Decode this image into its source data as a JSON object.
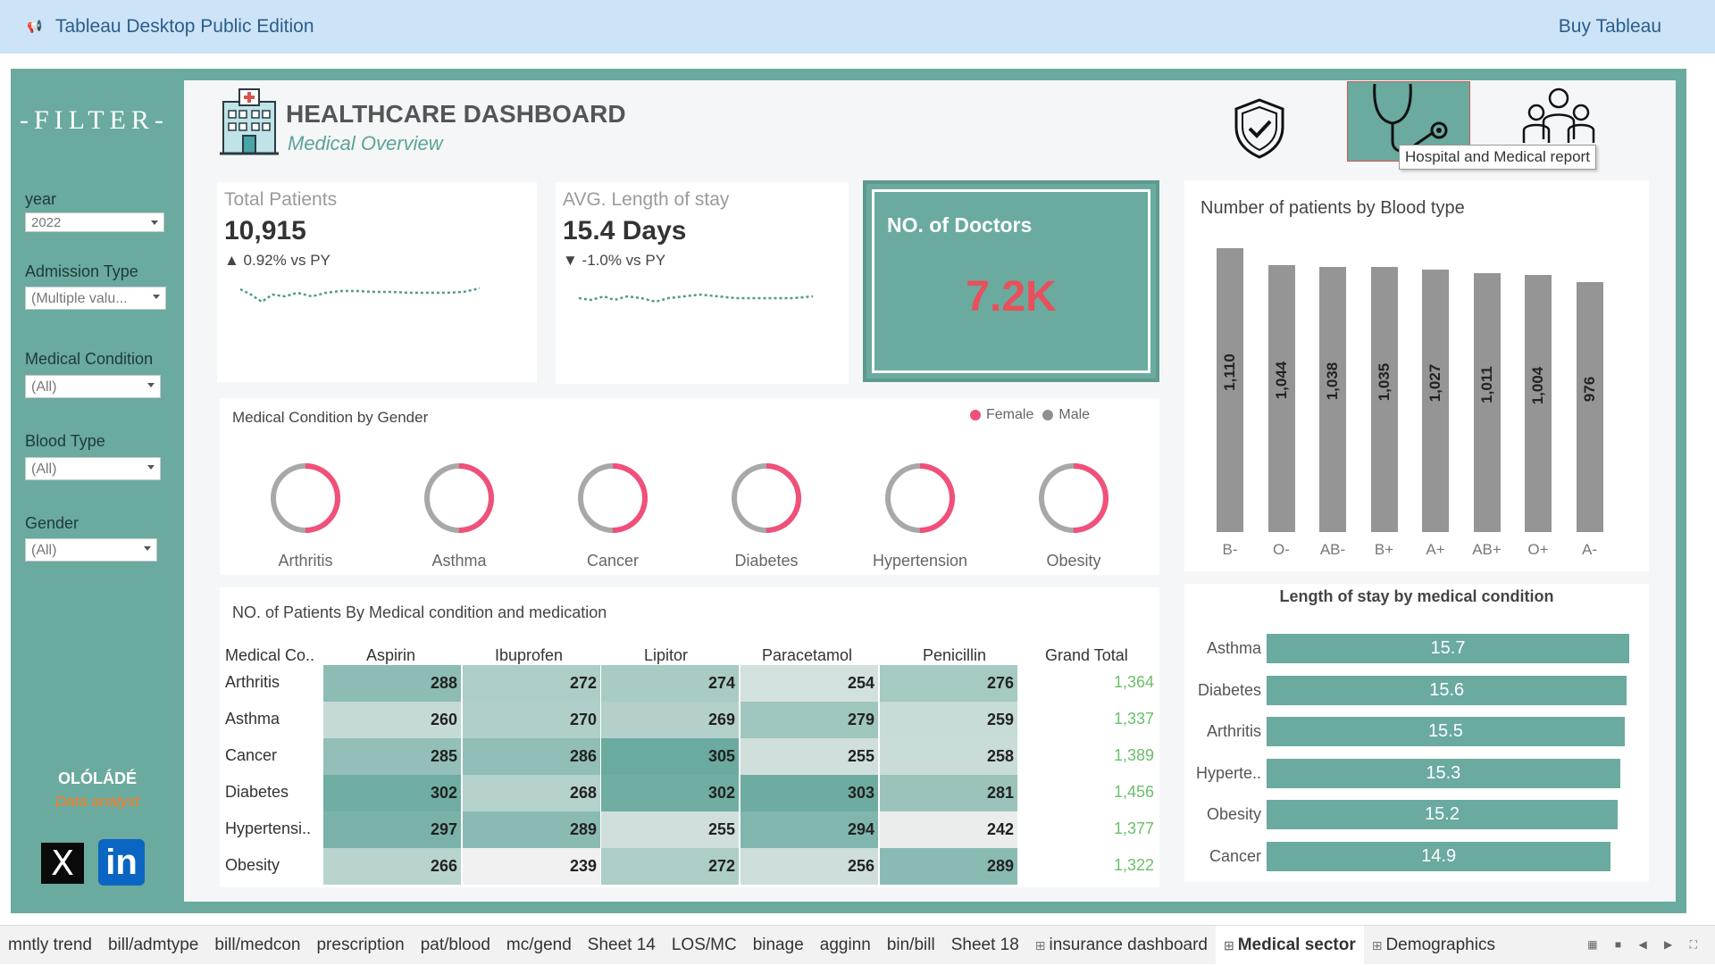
{
  "topbar": {
    "title": "Tableau Desktop Public Edition",
    "buy": "Buy Tableau",
    "icon": "tableau-icon"
  },
  "sidebar": {
    "title": "-FILTER-",
    "filters": [
      {
        "label": "year",
        "value": "2022"
      },
      {
        "label": "Admission Type",
        "value": "(Multiple valu..."
      },
      {
        "label": "Medical Condition",
        "value": "(All)"
      },
      {
        "label": "Blood Type",
        "value": "(All)"
      },
      {
        "label": "Gender",
        "value": "(All)"
      }
    ],
    "author": {
      "name": "OLÓLÁDÉ",
      "role": "Data analyst"
    },
    "social": {
      "x": "X",
      "linkedin": "in"
    }
  },
  "header": {
    "title": "HEALTHCARE DASHBOARD",
    "subtitle": "Medical Overview",
    "tooltip": "Hospital and Medical report"
  },
  "kpis": {
    "patients": {
      "label": "Total Patients",
      "value": "10,915",
      "delta": "▲ 0.92% vs PY"
    },
    "stay": {
      "label": "AVG. Length of stay",
      "value": "15.4 Days",
      "delta": "▼ -1.0% vs PY"
    },
    "doctors": {
      "label": "NO. of Doctors",
      "value": "7.2K"
    }
  },
  "gender_chart": {
    "title": "Medical Condition by Gender",
    "legend": [
      "Female",
      "Male"
    ],
    "colors": {
      "female": "#f0507a",
      "male": "#a8a8a8"
    },
    "conditions": [
      {
        "name": "Arthritis",
        "female": 0.5
      },
      {
        "name": "Asthma",
        "female": 0.5
      },
      {
        "name": "Cancer",
        "female": 0.5
      },
      {
        "name": "Diabetes",
        "female": 0.5
      },
      {
        "name": "Hypertension",
        "female": 0.5
      },
      {
        "name": "Obesity",
        "female": 0.5
      }
    ]
  },
  "table": {
    "title": "NO. of Patients By Medical condition and medication",
    "corner": "Medical Co..",
    "columns": [
      "Aspirin",
      "Ibuprofen",
      "Lipitor",
      "Paracetamol",
      "Penicillin"
    ],
    "grand_total_label": "Grand Total",
    "rows": [
      {
        "label": "Arthritis",
        "values": [
          288,
          272,
          274,
          254,
          276
        ],
        "total": "1,364"
      },
      {
        "label": "Asthma",
        "values": [
          260,
          270,
          269,
          279,
          259
        ],
        "total": "1,337"
      },
      {
        "label": "Cancer",
        "values": [
          285,
          286,
          305,
          255,
          258
        ],
        "total": "1,389"
      },
      {
        "label": "Diabetes",
        "values": [
          302,
          268,
          302,
          303,
          281
        ],
        "total": "1,456"
      },
      {
        "label": "Hypertensi..",
        "values": [
          297,
          289,
          255,
          294,
          242
        ],
        "total": "1,377"
      },
      {
        "label": "Obesity",
        "values": [
          266,
          239,
          272,
          256,
          289
        ],
        "total": "1,322"
      }
    ]
  },
  "chart_data": [
    {
      "type": "bar",
      "title": "Number of patients by Blood type",
      "categories": [
        "B-",
        "O-",
        "AB-",
        "B+",
        "A+",
        "AB+",
        "O+",
        "A-"
      ],
      "values": [
        1110,
        1044,
        1038,
        1035,
        1027,
        1011,
        1004,
        976
      ],
      "value_labels": [
        "1,110",
        "1,044",
        "1,038",
        "1,035",
        "1,027",
        "1,011",
        "1,004",
        "976"
      ],
      "color": "#959595"
    },
    {
      "type": "bar",
      "title": "Length of stay by medical condition",
      "categories": [
        "Asthma",
        "Diabetes",
        "Arthritis",
        "Hyperte..",
        "Obesity",
        "Cancer"
      ],
      "values": [
        15.7,
        15.6,
        15.5,
        15.3,
        15.2,
        14.9
      ],
      "color": "#6aaa9f"
    }
  ],
  "tabs": [
    {
      "label": "mntly trend"
    },
    {
      "label": "bill/admtype"
    },
    {
      "label": "bill/medcon"
    },
    {
      "label": "prescription"
    },
    {
      "label": "pat/blood"
    },
    {
      "label": "mc/gend"
    },
    {
      "label": "Sheet 14"
    },
    {
      "label": "LOS/MC"
    },
    {
      "label": "binage"
    },
    {
      "label": "agginn"
    },
    {
      "label": "bin/bill"
    },
    {
      "label": "Sheet 18"
    },
    {
      "label": "insurance dashboard",
      "dashboard": true
    },
    {
      "label": "Medical sector",
      "dashboard": true,
      "active": true
    },
    {
      "label": "Demographics",
      "dashboard": true
    }
  ]
}
